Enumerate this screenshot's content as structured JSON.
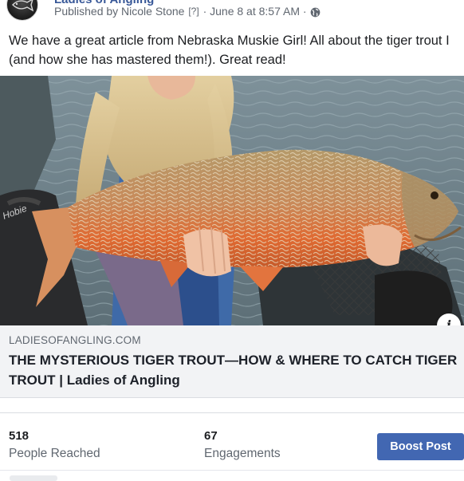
{
  "header": {
    "page_name": "Ladies of Angling",
    "published_by": "Published by Nicole Stone",
    "help_marker": "[?]",
    "separator": "·",
    "timestamp": "June 8 at 8:57 AM",
    "audience_icon": "globe-icon"
  },
  "post": {
    "text": "We have a great article from Nebraska Muskie Girl! All about the tiger trout I (and how she has mastered them!). Great read!"
  },
  "photo": {
    "description_icon": "info-icon",
    "info_label": "i"
  },
  "link_preview": {
    "domain": "LADIESOFANGLING.COM",
    "title": "THE MYSTERIOUS TIGER TROUT—HOW & WHERE TO CATCH TIGER TROUT | Ladies of Angling"
  },
  "insights": {
    "reached_value": "518",
    "reached_label": "People Reached",
    "engagements_value": "67",
    "engagements_label": "Engagements"
  },
  "actions": {
    "boost_label": "Boost Post"
  },
  "colors": {
    "link_blue": "#385898",
    "boost_blue": "#4267b2",
    "card_bg": "#f2f3f5",
    "meta_gray": "#606770"
  }
}
